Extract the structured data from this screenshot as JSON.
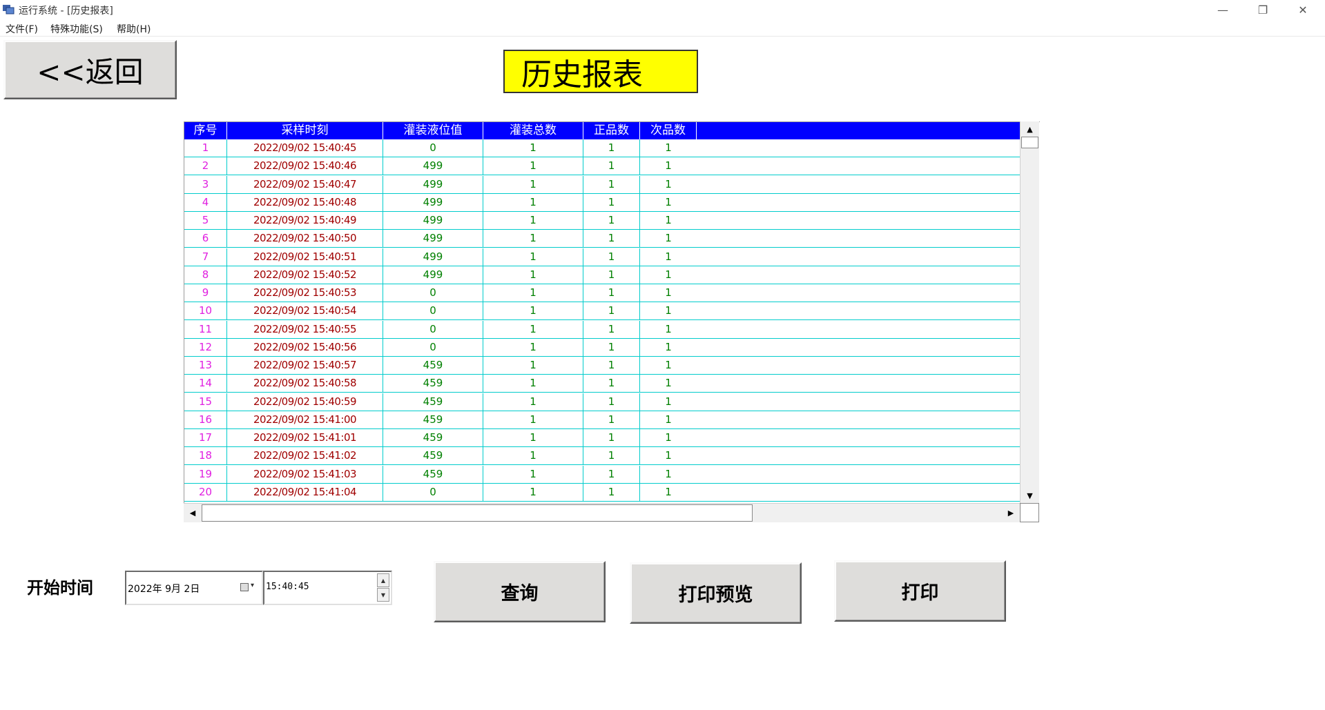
{
  "window": {
    "title": "运行系统 - [历史报表]",
    "minimize_glyph": "—",
    "restore_glyph": "❐",
    "close_glyph": "✕"
  },
  "menu": {
    "items": [
      "文件(F)",
      "特殊功能(S)",
      "帮助(H)"
    ]
  },
  "back_button": {
    "label": "<<返回"
  },
  "page_title": "历史报表",
  "grid": {
    "columns": [
      "序号",
      "采样时刻",
      "灌装液位值",
      "灌装总数",
      "正品数",
      "次品数"
    ],
    "rows": [
      [
        "1",
        "2022/09/02 15:40:45",
        "0",
        "1",
        "1",
        "1"
      ],
      [
        "2",
        "2022/09/02 15:40:46",
        "499",
        "1",
        "1",
        "1"
      ],
      [
        "3",
        "2022/09/02 15:40:47",
        "499",
        "1",
        "1",
        "1"
      ],
      [
        "4",
        "2022/09/02 15:40:48",
        "499",
        "1",
        "1",
        "1"
      ],
      [
        "5",
        "2022/09/02 15:40:49",
        "499",
        "1",
        "1",
        "1"
      ],
      [
        "6",
        "2022/09/02 15:40:50",
        "499",
        "1",
        "1",
        "1"
      ],
      [
        "7",
        "2022/09/02 15:40:51",
        "499",
        "1",
        "1",
        "1"
      ],
      [
        "8",
        "2022/09/02 15:40:52",
        "499",
        "1",
        "1",
        "1"
      ],
      [
        "9",
        "2022/09/02 15:40:53",
        "0",
        "1",
        "1",
        "1"
      ],
      [
        "10",
        "2022/09/02 15:40:54",
        "0",
        "1",
        "1",
        "1"
      ],
      [
        "11",
        "2022/09/02 15:40:55",
        "0",
        "1",
        "1",
        "1"
      ],
      [
        "12",
        "2022/09/02 15:40:56",
        "0",
        "1",
        "1",
        "1"
      ],
      [
        "13",
        "2022/09/02 15:40:57",
        "459",
        "1",
        "1",
        "1"
      ],
      [
        "14",
        "2022/09/02 15:40:58",
        "459",
        "1",
        "1",
        "1"
      ],
      [
        "15",
        "2022/09/02 15:40:59",
        "459",
        "1",
        "1",
        "1"
      ],
      [
        "16",
        "2022/09/02 15:41:00",
        "459",
        "1",
        "1",
        "1"
      ],
      [
        "17",
        "2022/09/02 15:41:01",
        "459",
        "1",
        "1",
        "1"
      ],
      [
        "18",
        "2022/09/02 15:41:02",
        "459",
        "1",
        "1",
        "1"
      ],
      [
        "19",
        "2022/09/02 15:41:03",
        "459",
        "1",
        "1",
        "1"
      ],
      [
        "20",
        "2022/09/02 15:41:04",
        "0",
        "1",
        "1",
        "1"
      ]
    ]
  },
  "scroll": {
    "up": "▲",
    "down": "▼",
    "left": "◀",
    "right": "▶"
  },
  "controls": {
    "start_label": "开始时间",
    "date_value": "2022年 9月 2日",
    "time_value": "15:40:45",
    "caret": "▾",
    "spin_up": "▲",
    "spin_down": "▼"
  },
  "buttons": {
    "query": "查询",
    "print_preview": "打印预览",
    "print": "打印"
  },
  "colors": {
    "header_bg": "#0000ff",
    "title_bg": "#ffff00",
    "index_text": "#e020e0",
    "time_text": "#a00000",
    "value_text": "#008000",
    "grid_line": "#00cccc"
  }
}
